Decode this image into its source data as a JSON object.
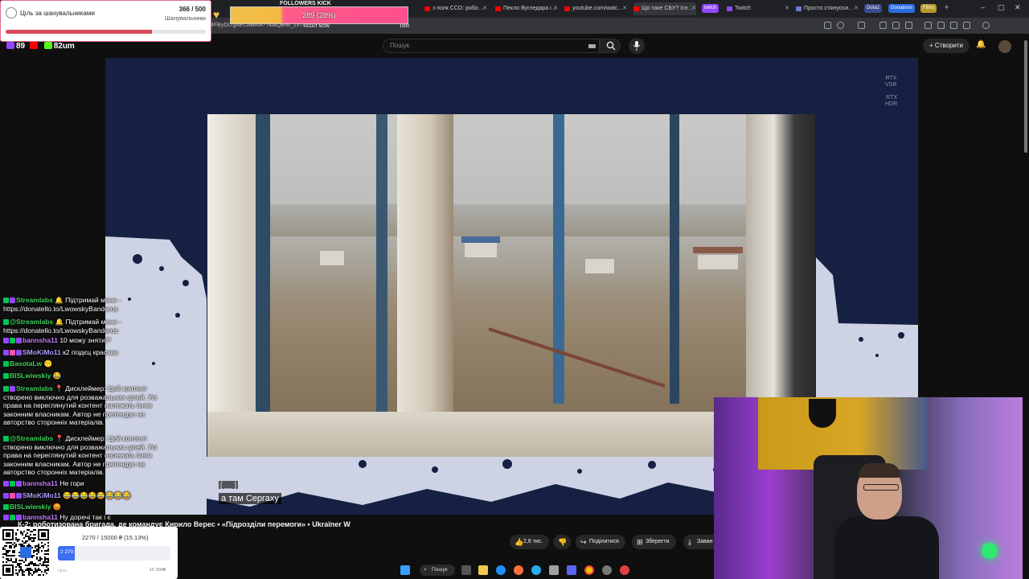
{
  "browser": {
    "tabs": [
      {
        "label": "з полк ССО: робо…"
      },
      {
        "label": "Пекло Вугледара і…"
      },
      {
        "label": "youtube.com/watc…"
      },
      {
        "label": "Що таке СБУ? Існ…"
      },
      {
        "label": "Twitch"
      },
      {
        "label": "Просто стікнуоси…"
      }
    ],
    "pills": [
      "Dota2",
      "Donations",
      "Films"
    ],
    "url": "4FByDLrg4ECABAIK- ndaQBMl_2x7l",
    "accent": "#ff0000"
  },
  "overlay": {
    "goal": {
      "title": "Ціль за шанувальниками",
      "count": "366 / 500",
      "sub": "Шанувальники",
      "progress": 0.732
    },
    "kick": {
      "title": "FOLLOWERS KICK",
      "value": "289 (28%)",
      "now_label": "RIGHT NOW",
      "max_label": "1000",
      "progress": 0.289
    },
    "viewers": {
      "twitch": "89",
      "youtube": "",
      "kick": "82",
      "suffix": "um"
    }
  },
  "youtube": {
    "search_placeholder": "Пошук",
    "create_label": "Створити"
  },
  "player": {
    "rtx1": [
      "RTX",
      "VSR"
    ],
    "rtx2": [
      "RTX",
      "HDR"
    ],
    "subtitle_tag": "[ __ ]",
    "subtitle": "а там Сергаху"
  },
  "video": {
    "title": "К-2: роботизована бригада, де командує Кирило Верес • «Підрозділи перемоги» • Ukraїner W",
    "actions": {
      "likes": "2,6 тис.",
      "share": "Поділитися",
      "save": "Зберегти",
      "download": "Заван"
    }
  },
  "chat": [
    {
      "badges": [
        "green",
        "purple"
      ],
      "user": "Streamlabs",
      "ucolor": "green",
      "text": "🔔 Підтримай мене - https://donatello.to/LwowskyBanderos"
    },
    {
      "badges": [
        "green"
      ],
      "user": "@Streamlabs",
      "ucolor": "green",
      "text": "🔔 Підтримай мене - https://donatello.to/LwowskyBanderos"
    },
    {
      "badges": [
        "purple",
        "green",
        "purple"
      ],
      "user": "bannsha11",
      "ucolor": "purple",
      "text": "10 можу зняти!?"
    },
    {
      "badges": [
        "purple",
        "pink",
        "purple"
      ],
      "user": "SMoKiMo11",
      "ucolor": "violet",
      "text": "к2 піздєц красава"
    },
    {
      "badges": [
        "green"
      ],
      "user": "BasotaLw",
      "ucolor": "green",
      "text": "😶"
    },
    {
      "badges": [
        "green"
      ],
      "user": "BISLwiwskiy",
      "ucolor": "green",
      "text": "😂"
    },
    {
      "badges": [
        "green",
        "purple"
      ],
      "user": "Streamlabs",
      "ucolor": "green",
      "text": "📍 Дисклеймер: Цей контент створено виключно для розважальних цілей. Усі права на переглянутий контент належать їхнім законним власникам. Автор не претендує на авторство сторонніх матеріалів."
    },
    {
      "badges": [
        "green"
      ],
      "user": "@Streamlabs",
      "ucolor": "green",
      "text": "📍 Дисклеймер: Цей контент створено виключно для розважальних цілей. Усі права на переглянутий контент належать їхнім законним власникам. Автор не претендує на авторство сторонніх матеріалів."
    },
    {
      "badges": [
        "purple",
        "green",
        "purple"
      ],
      "user": "bannsha11",
      "ucolor": "purple",
      "text": "Не гори"
    },
    {
      "badges": [
        "purple",
        "pink",
        "purple"
      ],
      "user": "SMoKiMo11",
      "ucolor": "violet",
      "text": "😂😂😂😂😂😂😂😂"
    },
    {
      "badges": [
        "green"
      ],
      "user": "BISLwiwskiy",
      "ucolor": "green",
      "text": "😡"
    },
    {
      "badges": [
        "purple",
        "green",
        "purple"
      ],
      "user": "bannsha11",
      "ucolor": "purple",
      "text": "Ну доречі так і є"
    }
  ],
  "donation": {
    "text": "2270 / 15000 ₴ (15.13%)",
    "bar_label": "2 270",
    "progress": 0.1513,
    "left_label": "Ціль",
    "right_label": "15 000₴"
  },
  "taskbar": {
    "search_label": "Пошук"
  }
}
